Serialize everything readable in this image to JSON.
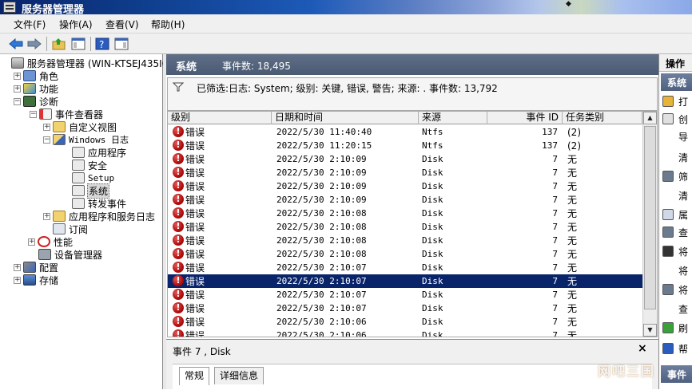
{
  "window": {
    "title": "服务器管理器"
  },
  "menu": {
    "file": "文件(F)",
    "action": "操作(A)",
    "view": "查看(V)",
    "help": "帮助(H)"
  },
  "tree": {
    "root": "服务器管理器 (WIN-KTSEJ435IO",
    "roles": "角色",
    "features": "功能",
    "diagnostics": "诊断",
    "event_viewer": "事件查看器",
    "custom_views": "自定义视图",
    "windows_logs": "Windows 日志",
    "application": "应用程序",
    "security": "安全",
    "setup": "Setup",
    "system": "系统",
    "forwarded": "转发事件",
    "app_service_logs": "应用程序和服务日志",
    "subscriptions": "订阅",
    "performance": "性能",
    "device_manager": "设备管理器",
    "configuration": "配置",
    "storage": "存储"
  },
  "header": {
    "title": "系统",
    "count_label": "事件数: 18,495"
  },
  "filter": {
    "text": "已筛选:日志: System; 级别: 关键, 错误, 警告; 来源: . 事件数: 13,792"
  },
  "columns": {
    "level": "级别",
    "datetime": "日期和时间",
    "source": "来源",
    "event_id": "事件 ID",
    "task": "任务类别"
  },
  "events": [
    {
      "level": "错误",
      "datetime": "2022/5/30 11:40:40",
      "source": "Ntfs",
      "event_id": "137",
      "task": "(2)"
    },
    {
      "level": "错误",
      "datetime": "2022/5/30 11:20:15",
      "source": "Ntfs",
      "event_id": "137",
      "task": "(2)"
    },
    {
      "level": "错误",
      "datetime": "2022/5/30 2:10:09",
      "source": "Disk",
      "event_id": "7",
      "task": "无"
    },
    {
      "level": "错误",
      "datetime": "2022/5/30 2:10:09",
      "source": "Disk",
      "event_id": "7",
      "task": "无"
    },
    {
      "level": "错误",
      "datetime": "2022/5/30 2:10:09",
      "source": "Disk",
      "event_id": "7",
      "task": "无"
    },
    {
      "level": "错误",
      "datetime": "2022/5/30 2:10:09",
      "source": "Disk",
      "event_id": "7",
      "task": "无"
    },
    {
      "level": "错误",
      "datetime": "2022/5/30 2:10:08",
      "source": "Disk",
      "event_id": "7",
      "task": "无"
    },
    {
      "level": "错误",
      "datetime": "2022/5/30 2:10:08",
      "source": "Disk",
      "event_id": "7",
      "task": "无"
    },
    {
      "level": "错误",
      "datetime": "2022/5/30 2:10:08",
      "source": "Disk",
      "event_id": "7",
      "task": "无"
    },
    {
      "level": "错误",
      "datetime": "2022/5/30 2:10:08",
      "source": "Disk",
      "event_id": "7",
      "task": "无"
    },
    {
      "level": "错误",
      "datetime": "2022/5/30 2:10:07",
      "source": "Disk",
      "event_id": "7",
      "task": "无"
    },
    {
      "level": "错误",
      "datetime": "2022/5/30 2:10:07",
      "source": "Disk",
      "event_id": "7",
      "task": "无",
      "selected": true
    },
    {
      "level": "错误",
      "datetime": "2022/5/30 2:10:07",
      "source": "Disk",
      "event_id": "7",
      "task": "无"
    },
    {
      "level": "错误",
      "datetime": "2022/5/30 2:10:07",
      "source": "Disk",
      "event_id": "7",
      "task": "无"
    },
    {
      "level": "错误",
      "datetime": "2022/5/30 2:10:06",
      "source": "Disk",
      "event_id": "7",
      "task": "无"
    },
    {
      "level": "错误",
      "datetime": "2022/5/30 2:10:06",
      "source": "Disk",
      "event_id": "7",
      "task": "无"
    }
  ],
  "detail": {
    "title": "事件 7 , Disk",
    "close": "×",
    "tab_general": "常规",
    "tab_details": "详细信息"
  },
  "actions": {
    "header": "操作",
    "section": "系统",
    "items": [
      "打",
      "创",
      "导",
      "清",
      "筛",
      "清",
      "属",
      "查",
      "将",
      "将",
      "将",
      "查",
      "刷",
      "帮"
    ],
    "section2": "事件"
  },
  "watermark": "网吧三国",
  "colors": {
    "header_bg": "#4a5a72",
    "selection": "#0a246a",
    "error": "#b10d0d"
  }
}
